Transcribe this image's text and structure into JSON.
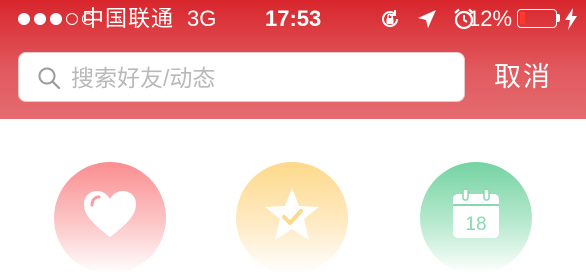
{
  "status_bar": {
    "signal_dots_filled": 3,
    "signal_dots_total": 5,
    "carrier": "中国联通",
    "network": "3G",
    "time": "17:53",
    "icons": [
      "orientation-lock-icon",
      "location-arrow-icon",
      "alarm-clock-icon"
    ],
    "battery_percent": "12%",
    "battery_level": 0.12,
    "charging_icon": "bolt-icon"
  },
  "search": {
    "placeholder": "搜索好友/动态",
    "value": "",
    "cancel_label": "取消"
  },
  "features": [
    {
      "icon": "heart-icon",
      "color": "#fa8e90"
    },
    {
      "icon": "star-check-icon",
      "color": "#fdd98a"
    },
    {
      "icon": "calendar-icon",
      "color": "#74d3a2",
      "calendar_day": "18"
    }
  ],
  "colors": {
    "header": "#d8262c",
    "battery_low": "#ff3b30"
  }
}
